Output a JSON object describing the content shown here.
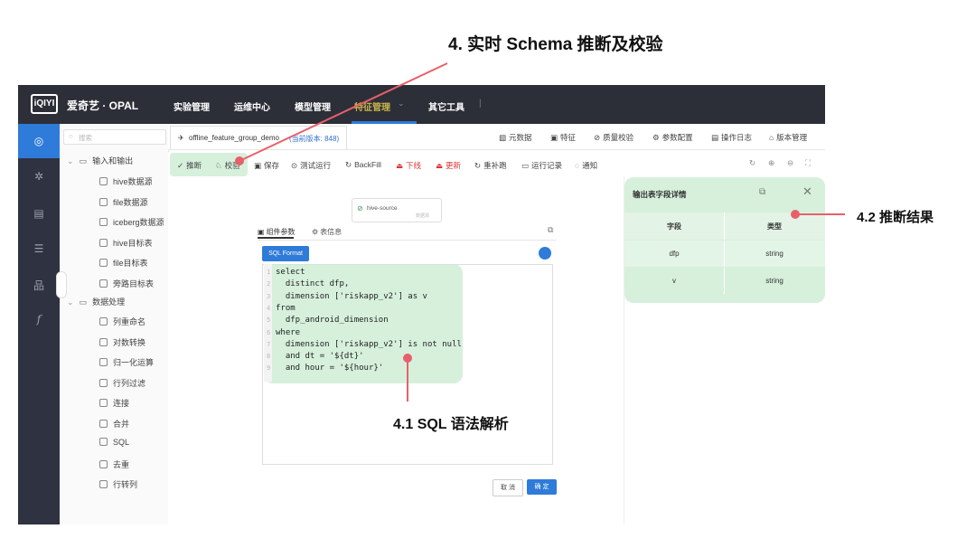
{
  "annotations": {
    "title": "4. 实时 Schema 推断及校验",
    "sql_parse": "4.1 SQL 语法解析",
    "infer_result": "4.2 推断结果"
  },
  "nav": {
    "logo": "iQIYI",
    "brand": "爱奇艺 · OPAL",
    "items": [
      "实验管理",
      "运维中心",
      "模型管理",
      "特征管理",
      "其它工具"
    ],
    "active_item": "特征管理",
    "separator": "|"
  },
  "search": {
    "placeholder": "搜索"
  },
  "tree": {
    "group1": "输入和输出",
    "group1_items": [
      "hive数据源",
      "file数据源",
      "iceberg数据源",
      "hive目标表",
      "file目标表",
      "旁路目标表"
    ],
    "group2": "数据处理",
    "group2_items": [
      "列重命名",
      "对数转换",
      "归一化运算",
      "行列过滤",
      "连接",
      "合并",
      "SQL",
      "去重",
      "行转列"
    ]
  },
  "tab": {
    "name": "offline_feature_group_demo",
    "version": "(当前版本: 848)",
    "right_items": [
      "元数据",
      "特征",
      "质量校验",
      "参数配置",
      "操作日志",
      "版本管理"
    ]
  },
  "toolbar": {
    "items": [
      "推断",
      "校验",
      "保存",
      "测试运行",
      "BackFill",
      "下线",
      "更新",
      "重补跑",
      "运行记录",
      "通知"
    ]
  },
  "canvas": {
    "node_label": "hive-source",
    "node_sub": "数据源",
    "panel_tabs": [
      "组件参数",
      "表信息"
    ],
    "format_button": "SQL Format",
    "code_lines": [
      "select",
      "  distinct dfp,",
      "  dimension ['riskapp_v2'] as v",
      "from",
      "  dfp_android_dimension",
      "where",
      "  dimension ['riskapp_v2'] is not null",
      "  and dt = '${dt}'",
      "  and hour = '${hour}'"
    ],
    "line_numbers": [
      "1",
      "2",
      "3",
      "4",
      "5",
      "6",
      "7",
      "8",
      "9"
    ],
    "cancel": "取 消",
    "confirm": "确 定"
  },
  "right_panel": {
    "title": "输出表字段详情",
    "columns": [
      "字段",
      "类型"
    ],
    "rows": [
      [
        "dfp",
        "string"
      ],
      [
        "v",
        "string"
      ]
    ]
  },
  "colors": {
    "nav_bg": "#2d2f38",
    "accent_blue": "#2f7bd9",
    "highlight_green": "#c8ebd0",
    "red": "#d33333",
    "annotation_line": "#e8606a"
  }
}
